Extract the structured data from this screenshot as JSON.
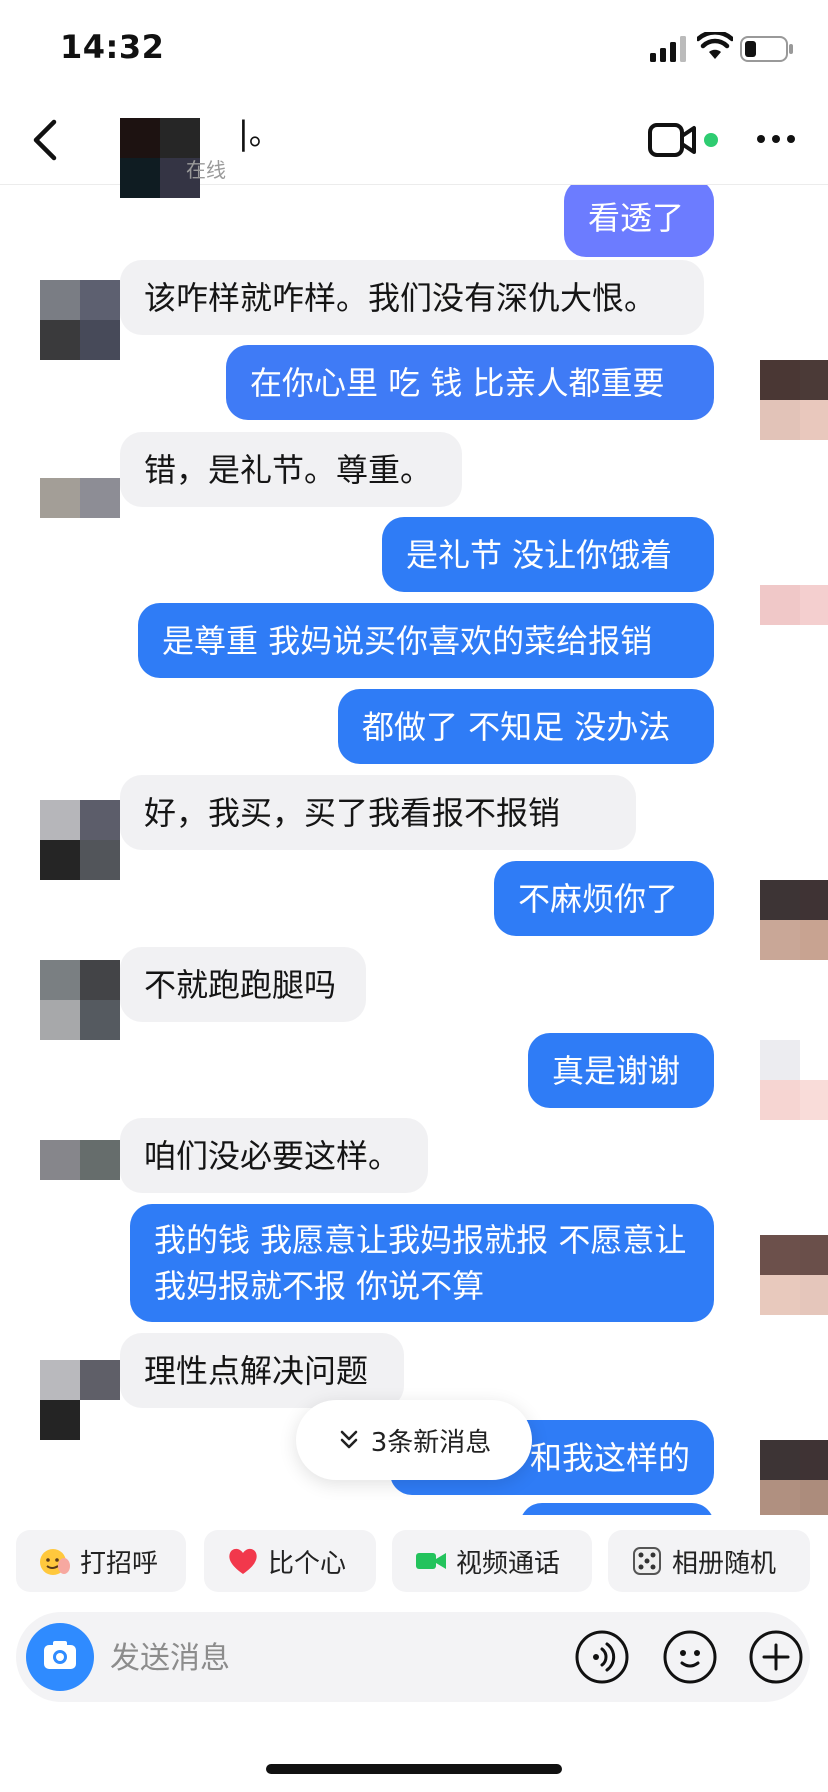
{
  "status_bar": {
    "time": "14:32"
  },
  "header": {
    "contact_name": "|。",
    "contact_status": "在线",
    "online_dot_color": "#2ecc71"
  },
  "colors": {
    "outgoing_bubble": "#2f7cf6",
    "outgoing_bubble_light": "#6c7cff",
    "incoming_bubble": "#f1f1f3"
  },
  "messages": [
    {
      "side": "out",
      "text": "看透了"
    },
    {
      "side": "in",
      "text": "该咋样就咋样。我们没有深仇大恨。"
    },
    {
      "side": "out",
      "text": "在你心里 吃 钱 比亲人都重要"
    },
    {
      "side": "in",
      "text": "错，是礼节。尊重。"
    },
    {
      "side": "out",
      "text": "是礼节 没让你饿着"
    },
    {
      "side": "out",
      "text": "是尊重 我妈说买你喜欢的菜给报销"
    },
    {
      "side": "out",
      "text": "都做了 不知足 没办法"
    },
    {
      "side": "in",
      "text": "好，我买，买了我看报不报销"
    },
    {
      "side": "out",
      "text": "不麻烦你了"
    },
    {
      "side": "in",
      "text": "不就跑跑腿吗"
    },
    {
      "side": "out",
      "text": "真是谢谢"
    },
    {
      "side": "in",
      "text": "咱们没必要这样。"
    },
    {
      "side": "out",
      "text": "我的钱 我愿意让我妈报就报 不愿意让我妈报就不报 你说不算"
    },
    {
      "side": "in",
      "text": "理性点解决问题"
    },
    {
      "side": "out",
      "text": "和我这样的"
    }
  ],
  "new_messages_pill": {
    "label": "3条新消息"
  },
  "quick_actions": [
    {
      "label": "打招呼",
      "icon": "wave-emoji-icon"
    },
    {
      "label": "比个心",
      "icon": "heart-icon"
    },
    {
      "label": "视频通话",
      "icon": "video-camera-icon"
    },
    {
      "label": "相册随机",
      "icon": "dice-icon"
    }
  ],
  "input": {
    "placeholder": "发送消息"
  }
}
